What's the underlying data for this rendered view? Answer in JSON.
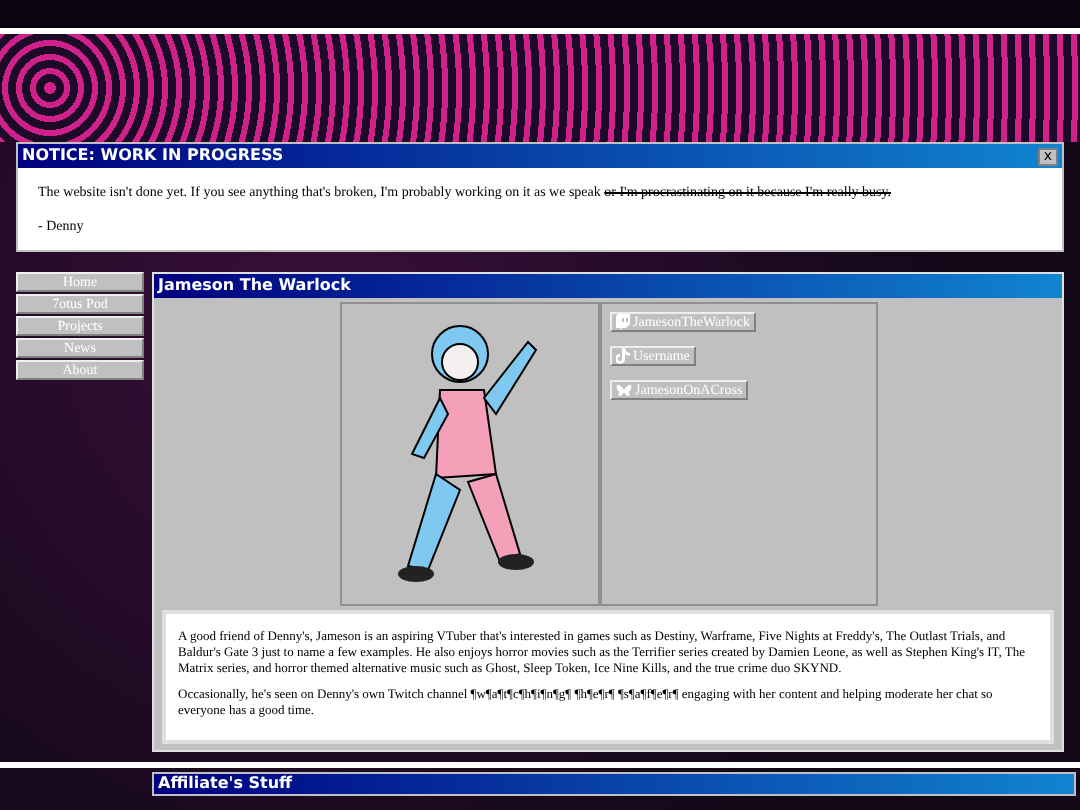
{
  "notice": {
    "title": "NOTICE: WORK IN PROGRESS",
    "close": "x",
    "message": "The website isn't done yet. If you see anything that's broken, I'm probably working on it as we speak ",
    "struck": "or I'm procrastinating on it because I'm really busy.",
    "signature": "- Denny"
  },
  "nav": [
    {
      "label": "Home"
    },
    {
      "label": "7otus Pod"
    },
    {
      "label": "Projects"
    },
    {
      "label": "News"
    },
    {
      "label": "About"
    }
  ],
  "profile": {
    "title": "Jameson The Warlock",
    "links": [
      {
        "kind": "twitch",
        "label": "JamesonTheWarlock"
      },
      {
        "kind": "tiktok",
        "label": "Username"
      },
      {
        "kind": "bluesky",
        "label": "JamesonOnACross"
      }
    ],
    "paragraphs": [
      "A good friend of Denny's, Jameson is an aspiring VTuber that's interested in games such as Destiny, Warframe, Five Nights at Freddy's, The Outlast Trials, and Baldur's Gate 3 just to name a few examples. He also enjoys horror movies such as the Terrifier series created by Damien Leone, as well as Stephen King's IT, The Matrix series, and horror themed alternative music such as Ghost, Sleep Token, Ice Nine Kills, and the true crime duo SKYND.",
      "Occasionally, he's seen on Denny's own Twitch channel ¶w¶a¶t¶c¶h¶i¶n¶g¶ ¶h¶e¶r¶ ¶s¶a¶f¶e¶r¶ engaging with her content and helping moderate her chat so everyone has a good time."
    ]
  },
  "affiliates": {
    "title": "Affiliate's Stuff"
  }
}
